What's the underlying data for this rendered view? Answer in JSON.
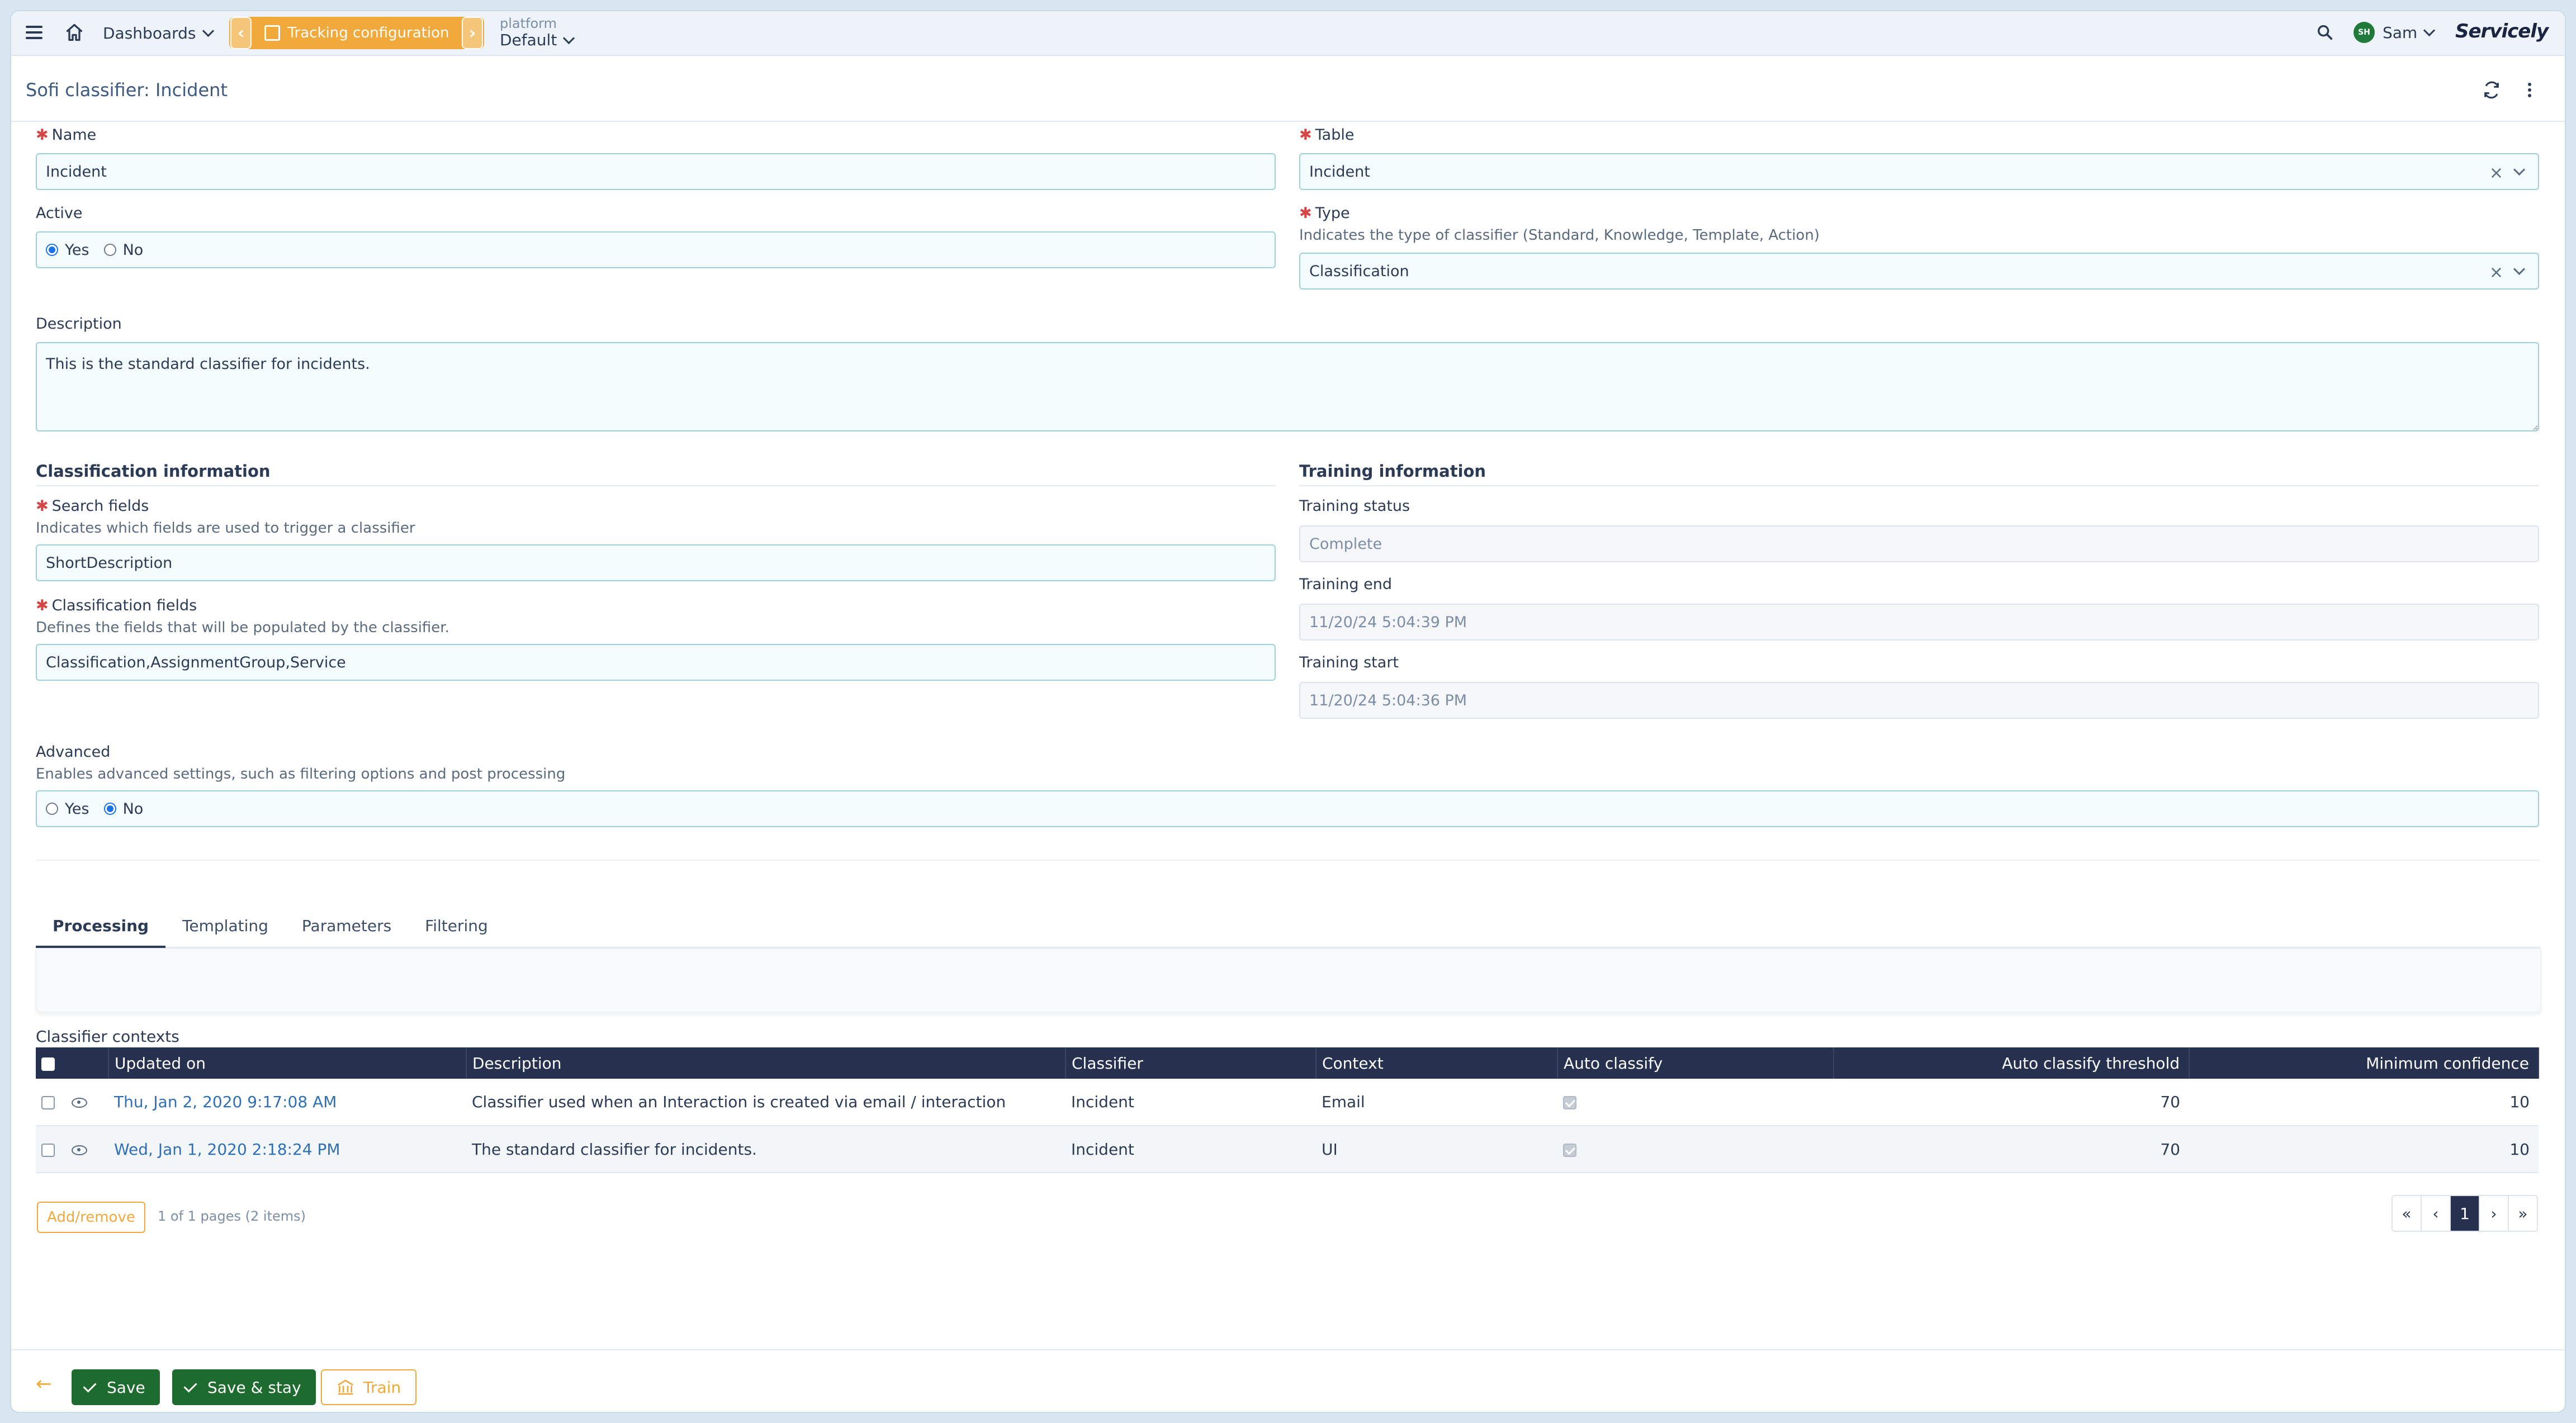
{
  "nav": {
    "dashboards": "Dashboards",
    "tracking": "Tracking configuration",
    "platform_small": "platform",
    "platform_value": "Default",
    "user_initials": "SH",
    "user_name": "Sam",
    "brand": "Servicely"
  },
  "page": {
    "title": "Sofi classifier: Incident"
  },
  "form": {
    "name_label": "Name",
    "name_value": "Incident",
    "table_label": "Table",
    "table_value": "Incident",
    "active_label": "Active",
    "active_yes": "Yes",
    "active_no": "No",
    "type_label": "Type",
    "type_hint": "Indicates the type of classifier (Standard, Knowledge, Template, Action)",
    "type_value": "Classification",
    "description_label": "Description",
    "description_value": "This is the standard classifier for incidents.",
    "classification_section": "Classification information",
    "search_fields_label": "Search fields",
    "search_fields_hint": "Indicates which fields are used to trigger a classifier",
    "search_fields_value": "ShortDescription",
    "classification_fields_label": "Classification fields",
    "classification_fields_hint": "Defines the fields that will be populated by the classifier.",
    "classification_fields_value": "Classification,AssignmentGroup,Service",
    "training_section": "Training information",
    "training_status_label": "Training status",
    "training_status_value": "Complete",
    "training_end_label": "Training end",
    "training_end_value": "11/20/24 5:04:39 PM",
    "training_start_label": "Training start",
    "training_start_value": "11/20/24 5:04:36 PM",
    "advanced_label": "Advanced",
    "advanced_hint": "Enables advanced settings, such as filtering options and post processing",
    "advanced_yes": "Yes",
    "advanced_no": "No"
  },
  "tabs": [
    "Processing",
    "Templating",
    "Parameters",
    "Filtering"
  ],
  "contexts": {
    "title": "Classifier contexts",
    "headers": [
      "Updated on",
      "Description",
      "Classifier",
      "Context",
      "Auto classify",
      "Auto classify threshold",
      "Minimum confidence"
    ],
    "rows": [
      {
        "updated": "Thu, Jan 2, 2020 9:17:08 AM",
        "description": "Classifier used when an Interaction is created via email / interaction",
        "classifier": "Incident",
        "context": "Email",
        "threshold": "70",
        "confidence": "10"
      },
      {
        "updated": "Wed, Jan 1, 2020 2:18:24 PM",
        "description": "The standard classifier for incidents.",
        "classifier": "Incident",
        "context": "UI",
        "threshold": "70",
        "confidence": "10"
      }
    ],
    "add_remove": "Add/remove",
    "page_info": "1 of 1 pages (2 items)",
    "current_page": "1"
  },
  "footer": {
    "save": "Save",
    "save_stay": "Save & stay",
    "train": "Train"
  },
  "colors": {
    "accent": "#f0a93a",
    "primary_dark": "#26304f",
    "save_green": "#1d6b2e"
  }
}
